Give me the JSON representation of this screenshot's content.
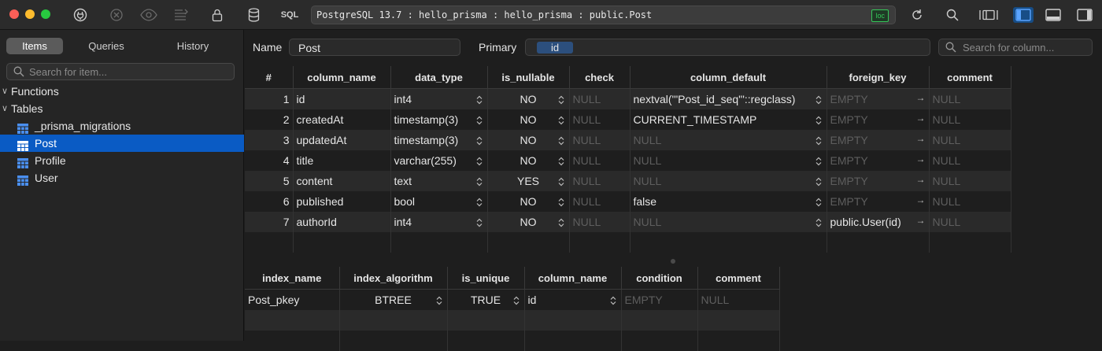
{
  "window": {
    "connection": "PostgreSQL 13.7 : hello_prisma : hello_prisma : public.Post",
    "badge": "loc",
    "sql_label": "SQL"
  },
  "sidebar": {
    "tabs": [
      "Items",
      "Queries",
      "History"
    ],
    "search_placeholder": "Search for item...",
    "groups": [
      {
        "label": "Functions",
        "expanded": false
      },
      {
        "label": "Tables",
        "expanded": true
      }
    ],
    "tables": [
      "_prisma_migrations",
      "Post",
      "Profile",
      "User"
    ],
    "selected_table": "Post"
  },
  "structure": {
    "name_label": "Name",
    "name_value": "Post",
    "primary_label": "Primary",
    "primary_token": "id",
    "column_search_placeholder": "Search for column..."
  },
  "columns": {
    "headers": [
      "#",
      "column_name",
      "data_type",
      "is_nullable",
      "check",
      "column_default",
      "foreign_key",
      "comment"
    ],
    "rows": [
      {
        "n": "1",
        "name": "id",
        "type": "int4",
        "nullable": "NO",
        "check": "NULL",
        "default": "nextval('\"Post_id_seq\"'::regclass)",
        "fk": "EMPTY",
        "comment": "NULL"
      },
      {
        "n": "2",
        "name": "createdAt",
        "type": "timestamp(3)",
        "nullable": "NO",
        "check": "NULL",
        "default": "CURRENT_TIMESTAMP",
        "fk": "EMPTY",
        "comment": "NULL"
      },
      {
        "n": "3",
        "name": "updatedAt",
        "type": "timestamp(3)",
        "nullable": "NO",
        "check": "NULL",
        "default": "NULL",
        "fk": "EMPTY",
        "comment": "NULL"
      },
      {
        "n": "4",
        "name": "title",
        "type": "varchar(255)",
        "nullable": "NO",
        "check": "NULL",
        "default": "NULL",
        "fk": "EMPTY",
        "comment": "NULL"
      },
      {
        "n": "5",
        "name": "content",
        "type": "text",
        "nullable": "YES",
        "check": "NULL",
        "default": "NULL",
        "fk": "EMPTY",
        "comment": "NULL"
      },
      {
        "n": "6",
        "name": "published",
        "type": "bool",
        "nullable": "NO",
        "check": "NULL",
        "default": "false",
        "fk": "EMPTY",
        "comment": "NULL"
      },
      {
        "n": "7",
        "name": "authorId",
        "type": "int4",
        "nullable": "NO",
        "check": "NULL",
        "default": "NULL",
        "fk": "public.User(id)",
        "comment": "NULL"
      }
    ]
  },
  "indexes": {
    "headers": [
      "index_name",
      "index_algorithm",
      "is_unique",
      "column_name",
      "condition",
      "comment"
    ],
    "rows": [
      {
        "name": "Post_pkey",
        "algorithm": "BTREE",
        "unique": "TRUE",
        "column": "id",
        "condition": "EMPTY",
        "comment": "NULL"
      }
    ]
  },
  "colors": {
    "accent": "#0a5bc4",
    "badge": "#35c759",
    "null_text": "#5e5e5e"
  }
}
